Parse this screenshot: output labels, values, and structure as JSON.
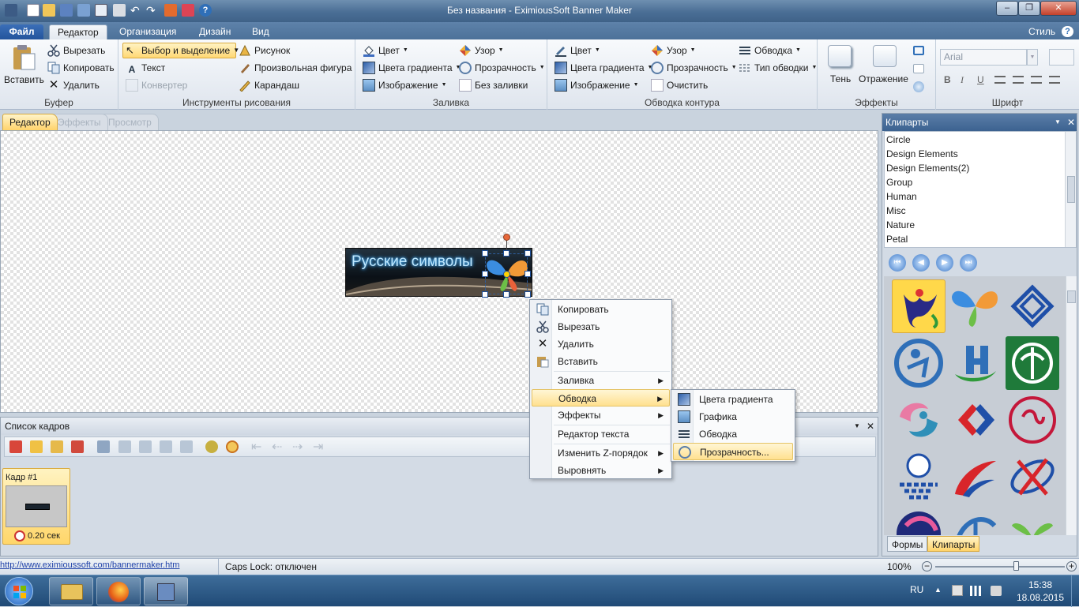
{
  "window": {
    "title": "Без названия - EximiousSoft Banner Maker",
    "min": "–",
    "max": "❐",
    "close": "✕"
  },
  "ribbon_tabs": [
    {
      "label": "Файл"
    },
    {
      "label": "Редактор"
    },
    {
      "label": "Организация"
    },
    {
      "label": "Дизайн"
    },
    {
      "label": "Вид"
    }
  ],
  "style_label": "Стиль",
  "ribbon": {
    "clipboard": {
      "paste": "Вставить",
      "cut": "Вырезать",
      "copy": "Копировать",
      "delete": "Удалить",
      "group": "Буфер"
    },
    "draw": {
      "select": "Выбор и выделение",
      "text": "Текст",
      "convert": "Конвертер",
      "picture": "Рисунок",
      "shape": "Произвольная фигура",
      "pencil": "Карандаш",
      "group": "Инструменты рисования"
    },
    "fill": {
      "color": "Цвет",
      "gradient": "Цвета градиента",
      "image": "Изображение",
      "pattern": "Узор",
      "transparency": "Прозрачность",
      "nofill": "Без заливки",
      "group": "Заливка"
    },
    "outline": {
      "color": "Цвет",
      "gradient": "Цвета градиента",
      "image": "Изображение",
      "pattern": "Узор",
      "transparency": "Прозрачность",
      "clear": "Очистить",
      "stroke": "Обводка",
      "stroke_type": "Тип обводки",
      "group": "Обводка контура"
    },
    "effects": {
      "shadow": "Тень",
      "reflection": "Отражение",
      "group": "Эффекты"
    },
    "font": {
      "name": "Arial",
      "bold": "B",
      "italic": "I",
      "underline": "U",
      "group": "Шрифт"
    }
  },
  "doc_tabs": [
    "Редактор",
    "Эффекты",
    "Просмотр"
  ],
  "banner": {
    "text": "Русские символы"
  },
  "context_menu": {
    "items": [
      {
        "label": "Копировать",
        "icon": "copy-icon"
      },
      {
        "label": "Вырезать",
        "icon": "scissors-icon"
      },
      {
        "label": "Удалить",
        "icon": "delete-icon"
      },
      {
        "label": "Вставить",
        "icon": "paste-icon"
      },
      {
        "label": "Заливка",
        "submenu": true
      },
      {
        "label": "Обводка",
        "submenu": true,
        "highlighted": true
      },
      {
        "label": "Эффекты",
        "submenu": true
      },
      {
        "label": "Редактор текста"
      },
      {
        "label": "Изменить Z-порядок",
        "submenu": true
      },
      {
        "label": "Выровнять",
        "submenu": true
      }
    ]
  },
  "submenu": {
    "items": [
      {
        "label": "Цвета градиента",
        "icon": "gradient-icon"
      },
      {
        "label": "Графика",
        "icon": "image-icon"
      },
      {
        "label": "Обводка",
        "icon": "lines-icon"
      },
      {
        "label": "Прозрачность...",
        "icon": "transparency-icon",
        "highlighted": true
      }
    ]
  },
  "frames_panel": {
    "title": "Список кадров",
    "frame_label": "Кадр #1",
    "frame_time": "0.20 сек"
  },
  "clipart_panel": {
    "title": "Клипарты",
    "categories": [
      "Circle",
      "Design Elements",
      "Design Elements(2)",
      "Group",
      "Human",
      "Misc",
      "Nature",
      "Petal"
    ],
    "bottom_tabs": [
      "Формы",
      "Клипарты"
    ]
  },
  "status": {
    "url": "http://www.eximioussoft.com/bannermaker.htm",
    "caps": "Caps Lock: отключен",
    "zoom": "100%",
    "zoom_level": 0.63
  },
  "taskbar": {
    "lang": "RU",
    "time": "15:38",
    "date": "18.08.2015"
  },
  "colors": {
    "accent": "#ffd874",
    "ribbon_bg": "#e6ebf2",
    "title_bg": "#4a6e95",
    "taskbar": "#2d5a86"
  }
}
